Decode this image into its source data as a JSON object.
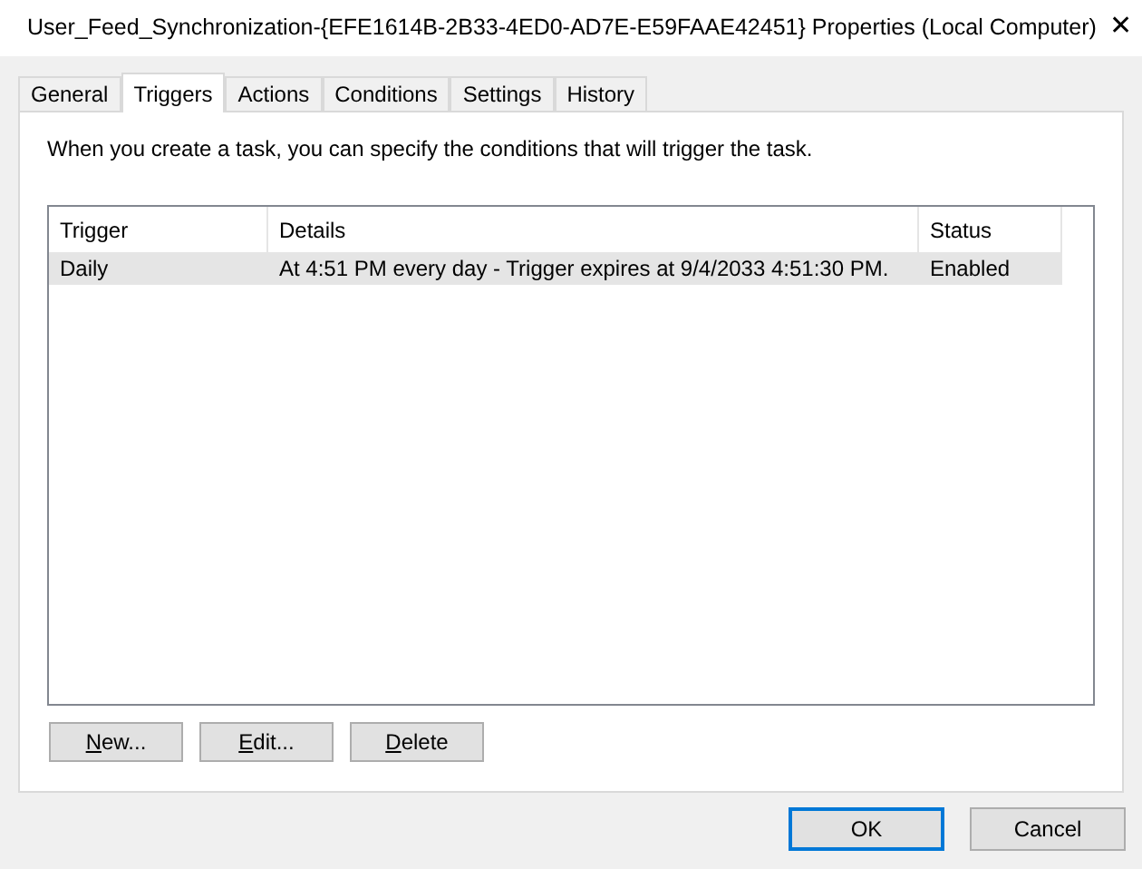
{
  "window": {
    "title": "User_Feed_Synchronization-{EFE1614B-2B33-4ED0-AD7E-E59FAAE42451} Properties (Local Computer)",
    "close": "✕"
  },
  "tabs": [
    {
      "label": "General",
      "selected": false
    },
    {
      "label": "Triggers",
      "selected": true
    },
    {
      "label": "Actions",
      "selected": false
    },
    {
      "label": "Conditions",
      "selected": false
    },
    {
      "label": "Settings",
      "selected": false
    },
    {
      "label": "History",
      "selected": false
    }
  ],
  "description": "When you create a task, you can specify the conditions that will trigger the task.",
  "table": {
    "columns": [
      "Trigger",
      "Details",
      "Status"
    ],
    "rows": [
      {
        "cells": [
          "Daily",
          "At 4:51 PM every day - Trigger expires at 9/4/2033 4:51:30 PM.",
          "Enabled"
        ],
        "selected": true
      }
    ]
  },
  "actions": [
    {
      "access_key": "N",
      "rest": "ew..."
    },
    {
      "access_key": "E",
      "rest": "dit..."
    },
    {
      "access_key": "D",
      "rest": "elete"
    }
  ],
  "buttons": [
    {
      "label": "OK",
      "default": true
    },
    {
      "label": "Cancel",
      "default": false
    }
  ]
}
